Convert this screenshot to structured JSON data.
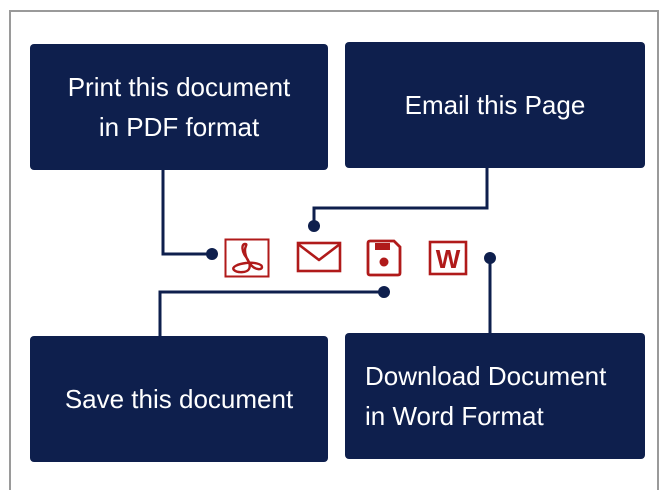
{
  "cards": {
    "print": {
      "lines": [
        "Print this document",
        "in PDF format"
      ]
    },
    "email": {
      "lines": [
        "Email this Page"
      ]
    },
    "save": {
      "lines": [
        "Save this document"
      ]
    },
    "word": {
      "lines": [
        "Download Document",
        "in Word Format"
      ]
    }
  },
  "icons": {
    "pdf": "pdf-icon",
    "email": "envelope-icon",
    "save": "save-disk-icon",
    "word": "word-icon",
    "word_letter": "W"
  },
  "colors": {
    "card_background": "#0e1f4d",
    "card_text": "#ffffff",
    "connector": "#0e1f4d",
    "icon": "#b01a1a",
    "frame": "#9a9a9a"
  }
}
